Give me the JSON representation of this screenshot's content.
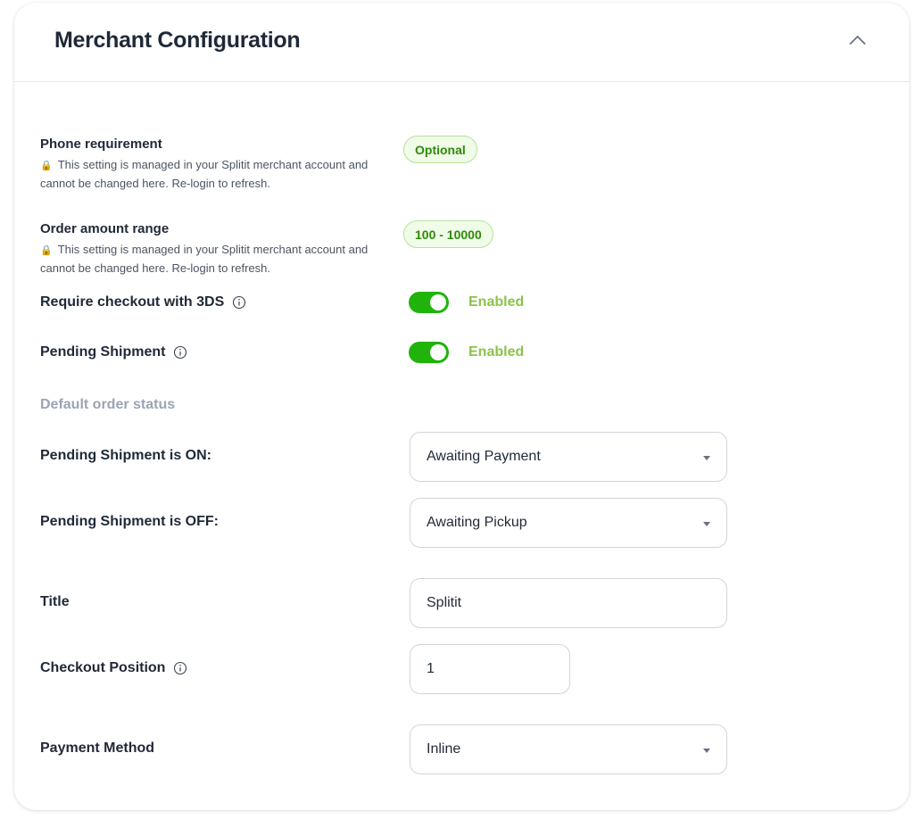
{
  "header": {
    "title": "Merchant Configuration",
    "collapse_icon": "chevron-up-icon"
  },
  "settings": {
    "phone": {
      "label": "Phone requirement",
      "note": "This setting is managed in your Splitit merchant account and cannot be changed here. Re-login to refresh.",
      "value": "Optional"
    },
    "amount": {
      "label": "Order amount range",
      "note": "This setting is managed in your Splitit merchant account and cannot be changed here. Re-login to refresh.",
      "value": "100 - 10000"
    },
    "lock_icon": "🔒",
    "three_ds": {
      "label": "Require checkout with 3DS",
      "state": "Enabled"
    },
    "pending_shipment": {
      "label": "Pending Shipment",
      "state": "Enabled"
    },
    "default_status_heading": "Default order status",
    "pending_on": {
      "label": "Pending Shipment is ON:",
      "value": "Awaiting Payment"
    },
    "pending_off": {
      "label": "Pending Shipment is OFF:",
      "value": "Awaiting Pickup"
    },
    "title": {
      "label": "Title",
      "value": "Splitit"
    },
    "checkout_position": {
      "label": "Checkout Position",
      "value": "1"
    },
    "payment_method": {
      "label": "Payment Method",
      "value": "Inline"
    }
  },
  "colors": {
    "toggle_on": "#1fb30b",
    "enabled_text": "#8bc34a",
    "pill_text": "#2f8a0a"
  }
}
